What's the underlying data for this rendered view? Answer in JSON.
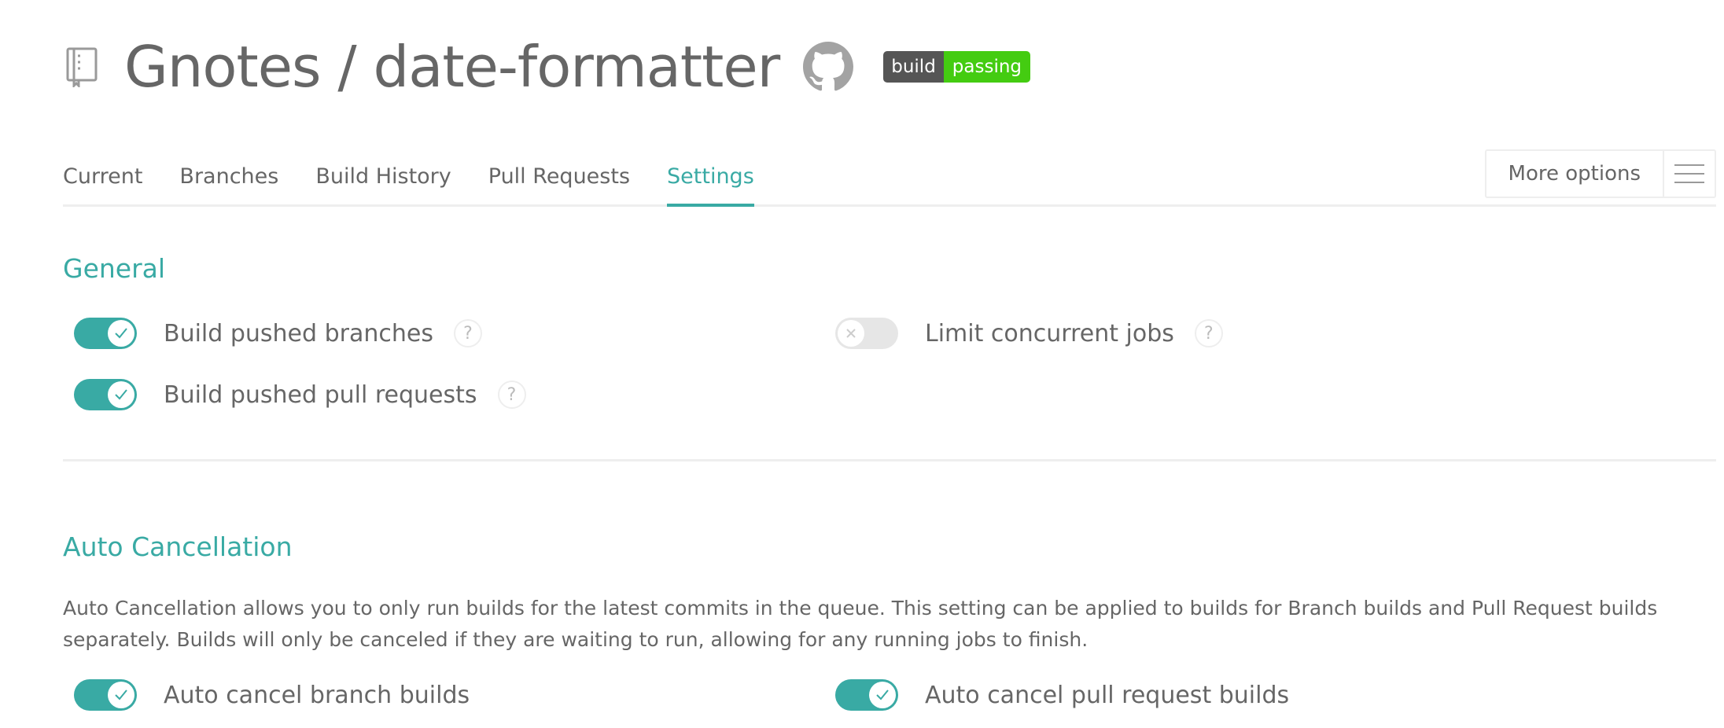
{
  "header": {
    "title": "Gnotes / date-formatter",
    "badge_left": "build",
    "badge_right": "passing",
    "icons": {
      "repo": "repo-icon",
      "github": "github-icon"
    }
  },
  "tabs": [
    {
      "label": "Current",
      "active": false
    },
    {
      "label": "Branches",
      "active": false
    },
    {
      "label": "Build History",
      "active": false
    },
    {
      "label": "Pull Requests",
      "active": false
    },
    {
      "label": "Settings",
      "active": true
    }
  ],
  "more_options": {
    "label": "More options"
  },
  "general": {
    "title": "General",
    "settings": [
      {
        "label": "Build pushed branches",
        "enabled": true
      },
      {
        "label": "Build pushed pull requests",
        "enabled": true
      },
      {
        "label": "Limit concurrent jobs",
        "enabled": false
      }
    ],
    "help_glyph": "?"
  },
  "auto_cancellation": {
    "title": "Auto Cancellation",
    "description": "Auto Cancellation allows you to only run builds for the latest commits in the queue. This setting can be applied to builds for Branch builds and Pull Request builds separately. Builds will only be canceled if they are waiting to run, allowing for any running jobs to finish.",
    "settings": [
      {
        "label": "Auto cancel branch builds",
        "enabled": true
      },
      {
        "label": "Auto cancel pull request builds",
        "enabled": true
      }
    ]
  },
  "colors": {
    "accent": "#39aaa4",
    "text": "#666666",
    "badge_dark": "#555555",
    "badge_green": "#44cc11",
    "toggle_off": "#e6e6e6"
  }
}
